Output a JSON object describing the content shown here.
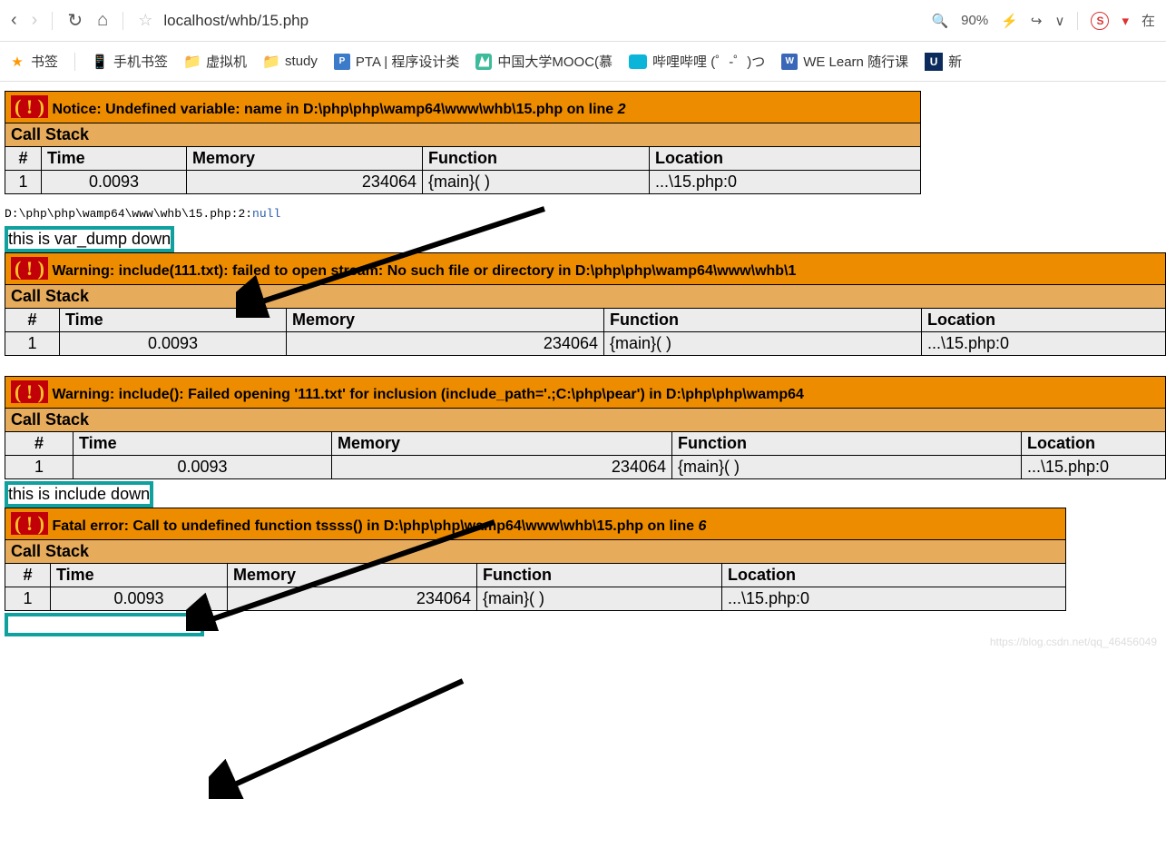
{
  "toolbar": {
    "url": "localhost/whb/15.php",
    "zoom": "90%",
    "right_label": "在"
  },
  "bookmarks": {
    "b1": "书签",
    "b2": "手机书签",
    "b3": "虚拟机",
    "b4": "study",
    "b5": "PTA | 程序设计类",
    "b6": "中国大学MOOC(慕",
    "b7": "哔哩哔哩 (゜-゜)つ",
    "b8": "WE Learn 随行课",
    "b9": "新"
  },
  "errors": {
    "callstack_label": "Call Stack",
    "hash": "#",
    "col_time": "Time",
    "col_memory": "Memory",
    "col_function": "Function",
    "col_location": "Location",
    "e1": {
      "type": "Notice",
      "msg": "Undefined variable: name in D:\\php\\php\\wamp64\\www\\whb\\15.php on line",
      "line": "2",
      "num": "1",
      "time": "0.0093",
      "memory": "234064",
      "func": "{main}( )",
      "loc": "...\\15.php:0"
    },
    "e2": {
      "type": "Warning",
      "msg": "include(111.txt): failed to open stream: No such file or directory in D:\\php\\php\\wamp64\\www\\whb\\1",
      "num": "1",
      "time": "0.0093",
      "memory": "234064",
      "func": "{main}( )",
      "loc": "...\\15.php:0"
    },
    "e3": {
      "type": "Warning",
      "msg": "include(): Failed opening '111.txt' for inclusion (include_path='.;C:\\php\\pear') in D:\\php\\php\\wamp64",
      "num": "1",
      "time": "0.0093",
      "memory": "234064",
      "func": "{main}( )",
      "loc": "...\\15.php:0"
    },
    "e4": {
      "type": "Fatal error",
      "msg": "Call to undefined function tssss() in D:\\php\\php\\wamp64\\www\\whb\\15.php on line",
      "line": "6",
      "num": "1",
      "time": "0.0093",
      "memory": "234064",
      "func": "{main}( )",
      "loc": "...\\15.php:0"
    }
  },
  "dump": {
    "path": "D:\\php\\php\\wamp64\\www\\whb\\15.php:2:",
    "value": "null"
  },
  "highlights": {
    "h1": "this is var_dump down",
    "h2": "this is include down",
    "h3": ""
  },
  "watermark": "https://blog.csdn.net/qq_46456049"
}
